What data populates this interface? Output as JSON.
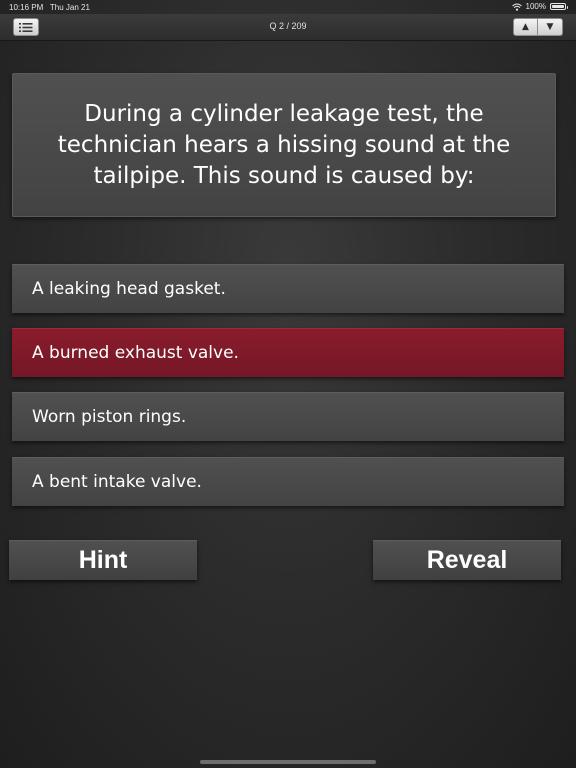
{
  "status_bar": {
    "time": "10:16 PM",
    "date": "Thu Jan 21",
    "battery": "100%",
    "wifi_icon": "wifi-icon",
    "battery_icon": "battery-icon"
  },
  "nav": {
    "menu_icon": "list-icon",
    "title": "Q 2 / 209",
    "prev_label": "▲",
    "next_label": "▼"
  },
  "question": {
    "text": "During a cylinder leakage test, the technician hears a hissing sound at the tailpipe. This sound is caused by:"
  },
  "answers": [
    {
      "label": "A leaking head gasket.",
      "selected": false
    },
    {
      "label": "A burned exhaust valve.",
      "selected": true
    },
    {
      "label": "Worn piston rings.",
      "selected": false
    },
    {
      "label": "A bent intake valve.",
      "selected": false
    }
  ],
  "buttons": {
    "hint_label": "Hint",
    "reveal_label": "Reveal"
  },
  "colors": {
    "selected_answer": "#7e1a2a",
    "card_background": "#4a4a4a",
    "page_background": "#2c2c2c"
  }
}
